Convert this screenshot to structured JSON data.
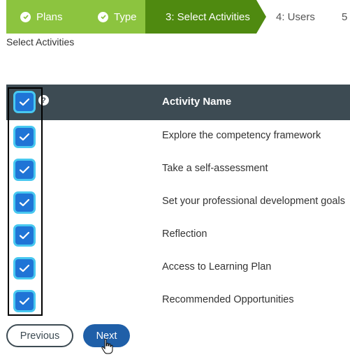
{
  "wizard": {
    "steps": [
      {
        "label": "Plans",
        "state": "done"
      },
      {
        "label": "Type",
        "state": "done"
      },
      {
        "label": "3: Select Activities",
        "state": "current"
      },
      {
        "label": "4: Users",
        "state": "upcoming"
      },
      {
        "label": "5",
        "state": "upcoming"
      }
    ]
  },
  "subtitle": "Select Activities",
  "table": {
    "header": {
      "activity_name": "Activity Name",
      "select_all_checked": true,
      "help_icon": "?"
    },
    "rows": [
      {
        "name": "Explore the competency framework",
        "checked": true
      },
      {
        "name": "Take a self-assessment",
        "checked": true
      },
      {
        "name": "Set your professional development goals",
        "checked": true
      },
      {
        "name": "Reflection",
        "checked": true
      },
      {
        "name": "Access to Learning Plan",
        "checked": true
      },
      {
        "name": "Recommended Opportunities",
        "checked": true
      }
    ]
  },
  "buttons": {
    "previous": "Previous",
    "next": "Next"
  },
  "icons": {
    "step_done": "check-circle-icon",
    "checkbox": "checkmark-icon",
    "help": "help-icon",
    "cursor": "hand-pointer-icon"
  },
  "colors": {
    "step_done": "#8cc43f",
    "step_current": "#4f8a10",
    "header_bg": "#3d4b53",
    "checkbox": "#1f74d6",
    "checkbox_glow": "#48c8f0",
    "next_button": "#1f5fa8"
  }
}
